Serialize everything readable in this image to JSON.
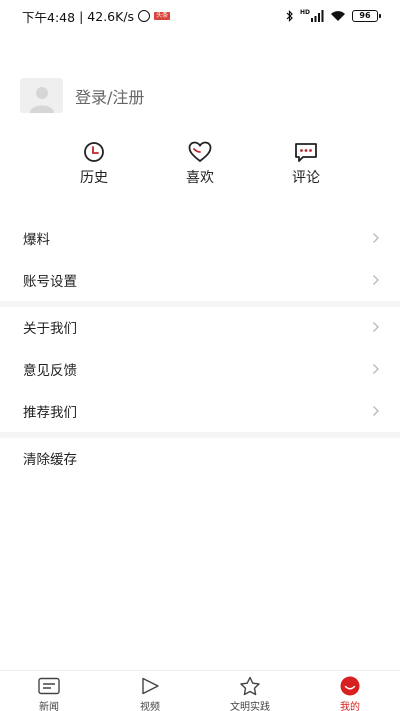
{
  "status_bar": {
    "time": "下午4:48",
    "separator": "|",
    "network_speed": "42.6K/s",
    "news_badge": "头条",
    "network_type": "HD",
    "battery": "96"
  },
  "profile": {
    "login_label": "登录/注册"
  },
  "shortcuts": [
    {
      "label": "历史",
      "icon": "clock-icon"
    },
    {
      "label": "喜欢",
      "icon": "heart-icon"
    },
    {
      "label": "评论",
      "icon": "comment-icon"
    }
  ],
  "menu": {
    "group1": [
      {
        "label": "爆料"
      },
      {
        "label": "账号设置"
      }
    ],
    "group2": [
      {
        "label": "关于我们"
      },
      {
        "label": "意见反馈"
      },
      {
        "label": "推荐我们"
      }
    ],
    "group3": [
      {
        "label": "清除缓存"
      }
    ]
  },
  "tab_bar": {
    "tabs": [
      {
        "label": "新闻",
        "icon": "news-icon"
      },
      {
        "label": "视频",
        "icon": "play-icon"
      },
      {
        "label": "文明实践",
        "icon": "star-icon"
      },
      {
        "label": "我的",
        "icon": "profile-icon"
      }
    ],
    "active_index": 3,
    "accent_color": "#d92020"
  }
}
